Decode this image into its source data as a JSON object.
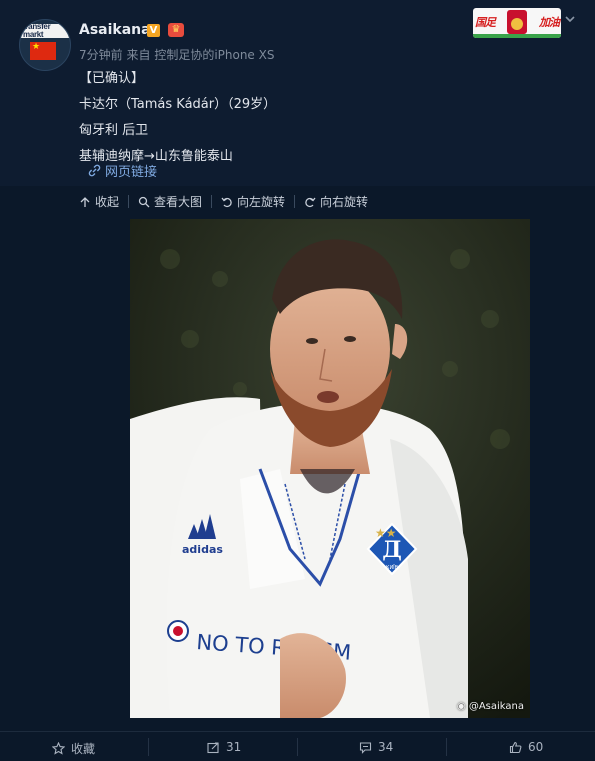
{
  "post": {
    "username": "Asaikana",
    "verified_badge": "V",
    "member_badge": "♛",
    "time": "7分钟前",
    "source_prefix": "来自",
    "source": "控制足协的iPhone XS",
    "lines": [
      "【已确认】",
      "卡达尔（Tamás Kádár）（29岁）",
      "匈牙利 后卫",
      "基辅迪纳摩→山东鲁能泰山"
    ],
    "web_link": "网页链接",
    "avatar_text": "transfer markt",
    "banner_left": "国足",
    "banner_right": "加油"
  },
  "toolbar": {
    "collapse": "收起",
    "view_large": "查看大图",
    "rotate_left": "向左旋转",
    "rotate_right": "向右旋转"
  },
  "image": {
    "watermark": "@Asaikana",
    "shirt_text": "NO TO RACISM",
    "club_badge": "КИЇВ",
    "sponsor": "adidas"
  },
  "actions": {
    "favorite": "收藏",
    "repost": "31",
    "comment": "34",
    "like": "60"
  },
  "colors": {
    "background": "#0a1628",
    "link": "#7fa9e0",
    "text": "#e2e6ec",
    "muted": "#7e8a9a"
  }
}
